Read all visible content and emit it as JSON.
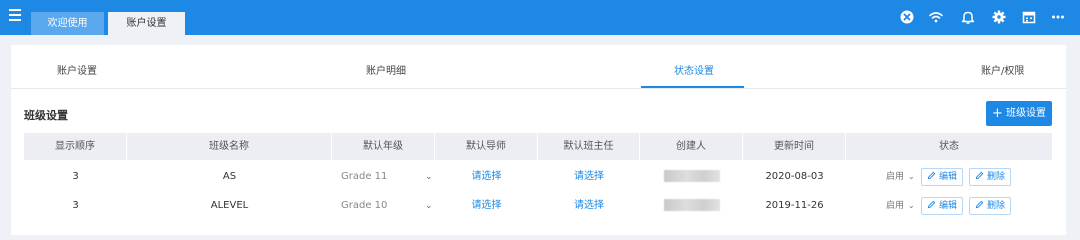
{
  "header": {
    "tabs": [
      "欢迎使用",
      "账户设置"
    ],
    "colors": {
      "bar": "#1e88e5",
      "accent": "#1e88e5"
    },
    "icons": [
      "menu-icon",
      "close-circle-icon",
      "wifi-icon",
      "bell-icon",
      "gear-icon",
      "calendar-icon",
      "more-icon"
    ]
  },
  "subtabs": [
    "账户设置",
    "账户明细",
    "状态设置",
    "账户/权限"
  ],
  "active_subtab": "状态设置",
  "section": {
    "title": "班级设置",
    "add_button": "班级设置"
  },
  "table": {
    "columns": [
      "显示顺序",
      "班级名称",
      "默认年级",
      "默认导师",
      "默认班主任",
      "创建人",
      "更新时间",
      "状态"
    ],
    "rows": [
      {
        "order": "3",
        "name": "AS",
        "grade": "Grade 11",
        "tutor": "请选择",
        "head": "请选择",
        "updated": "2020-08-03",
        "status": "启用",
        "edit": "编辑",
        "delete": "删除"
      },
      {
        "order": "3",
        "name": "ALEVEL",
        "grade": "Grade 10",
        "tutor": "请选择",
        "head": "请选择",
        "updated": "2019-11-26",
        "status": "启用",
        "edit": "编辑",
        "delete": "删除"
      }
    ]
  }
}
